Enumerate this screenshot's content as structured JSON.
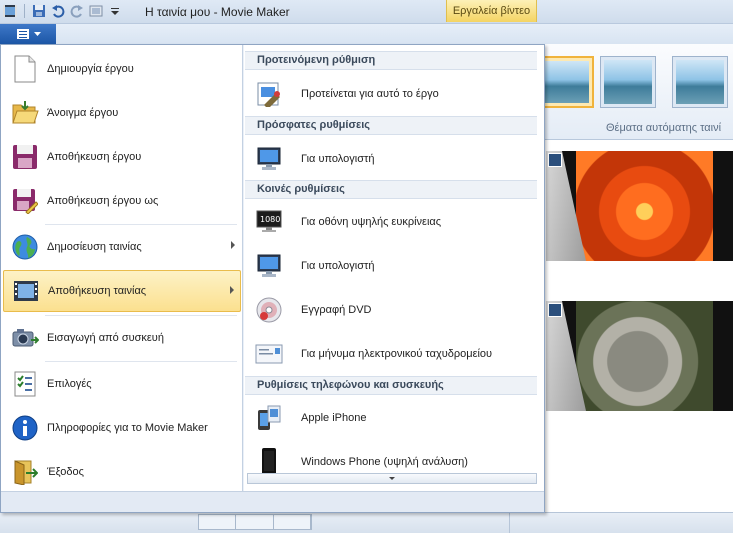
{
  "window": {
    "title": "Η ταινία μου - Movie Maker",
    "contextual_tab": "Εργαλεία βίντεο"
  },
  "ribbon": {
    "auto_themes_label": "Θέματα αυτόματης ταινί"
  },
  "menu": {
    "left_items": [
      {
        "label": "Δημιουργία έργου",
        "icon": "new-document-icon"
      },
      {
        "label": "Άνοιγμα έργου",
        "icon": "open-folder-icon"
      },
      {
        "label": "Αποθήκευση έργου",
        "icon": "save-icon"
      },
      {
        "label": "Αποθήκευση έργου ως",
        "icon": "save-as-icon"
      },
      {
        "label": "Δημοσίευση ταινίας",
        "icon": "globe-icon",
        "submenu": true
      },
      {
        "label": "Αποθήκευση ταινίας",
        "icon": "film-icon",
        "submenu": true,
        "highlighted": true
      },
      {
        "label": "Εισαγωγή από συσκευή",
        "icon": "camera-icon"
      },
      {
        "label": "Επιλογές",
        "icon": "options-icon"
      },
      {
        "label": "Πληροφορίες για το Movie Maker",
        "icon": "info-icon"
      },
      {
        "label": "Έξοδος",
        "icon": "exit-icon"
      }
    ],
    "right": {
      "recommended_header": "Προτεινόμενη ρύθμιση",
      "recommended_item": "Προτείνεται για αυτό το έργο",
      "recent_header": "Πρόσφατες ρυθμίσεις",
      "recent_item": "Για υπολογιστή",
      "common_header": "Κοινές ρυθμίσεις",
      "common_items": [
        {
          "label": "Για οθόνη υψηλής ευκρίνειας",
          "icon": "hd-monitor-icon"
        },
        {
          "label": "Για υπολογιστή",
          "icon": "computer-icon"
        },
        {
          "label": "Εγγραφή DVD",
          "icon": "dvd-icon"
        },
        {
          "label": "Για μήνυμα ηλεκτρονικού ταχυδρομείου",
          "icon": "email-icon"
        }
      ],
      "device_header": "Ρυθμίσεις τηλεφώνου και συσκευής",
      "device_items": [
        {
          "label": "Apple iPhone",
          "icon": "iphone-icon"
        },
        {
          "label": "Windows Phone (υψηλή ανάλυση)",
          "icon": "windows-phone-icon"
        }
      ]
    }
  }
}
